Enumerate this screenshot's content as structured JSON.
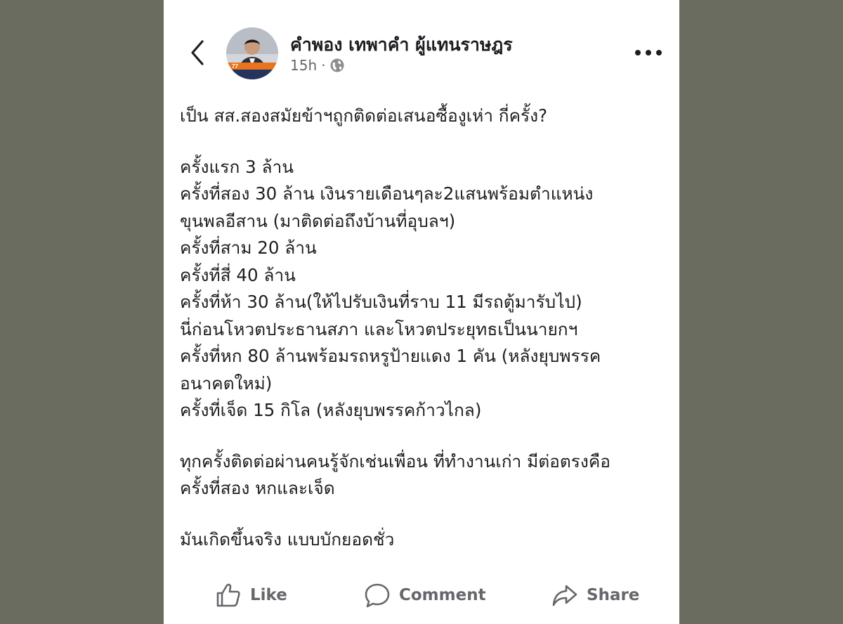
{
  "post": {
    "author": "คำพอง เทพาคำ ผู้แทนราษฎร",
    "time": "15h",
    "separator": "·",
    "visibility_icon": "globe-icon",
    "back_icon": "chevron-left-icon",
    "more_icon": "more-horizontal-icon",
    "lines": [
      "เป็น สส.สองสมัยข้าฯถูกติดต่อเสนอซื้องูเห่า กี่ครั้ง?",
      "",
      "ครั้งแรก 3 ล้าน",
      "ครั้งที่สอง 30 ล้าน เงินรายเดือนๆละ2แสนพร้อมตำแหน่ง",
      "ขุนพลอีสาน (มาติดต่อถึงบ้านที่อุบลฯ)",
      "ครั้งที่สาม 20 ล้าน",
      "ครั้งที่สี่ 40 ล้าน",
      "ครั้งที่ห้า 30 ล้าน(ให้ไปรับเงินที่ราบ 11 มีรถตู้มารับไป)",
      "นี่ก่อนโหวตประธานสภา และโหวตประยุทธเป็นนายกฯ",
      "ครั้งที่หก 80 ล้านพร้อมรถหรูป้ายแดง 1 คัน (หลังยุบพรรค",
      "อนาคตใหม่)",
      "ครั้งที่เจ็ด 15 กิโล (หลังยุบพรรคก้าวไกล)",
      "",
      "ทุกครั้งติดต่อผ่านคนรู้จักเช่นเพื่อน ที่ทำงานเก่า มีต่อตรงคือ",
      "ครั้งที่สอง หกและเจ็ด",
      "",
      "มันเกิดขึ้นจริง แบบบักยอดชั่ว"
    ]
  },
  "actions": {
    "like": "Like",
    "comment": "Comment",
    "share": "Share"
  },
  "colors": {
    "background": "#6b6c60",
    "card": "#ffffff",
    "text": "#1c1e21",
    "muted": "#65676b"
  }
}
